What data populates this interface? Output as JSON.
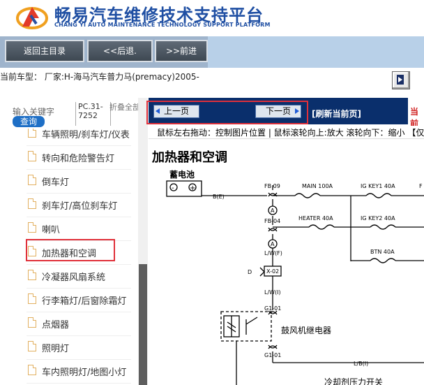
{
  "header": {
    "title": "畅易汽车维修技术支持平台",
    "subtitle": "CHANG YI AUTO MAINTENANCE TECHNOLOGY SUPPORT PLATFORM"
  },
  "toolbar": {
    "main_label": "返回主目录",
    "back_label": "<<后退.",
    "forward_label": ">>前进"
  },
  "car": {
    "label": "当前车型： 厂家:H-海马汽车普力马(premacy)2005-"
  },
  "search": {
    "keyword_label": "输入关键字",
    "query_label": "查询",
    "pc_code": "PC.31-7252",
    "collapse_label": "折叠全部"
  },
  "tree": {
    "items": [
      {
        "label": "车辆照明/刹车灯/仪表"
      },
      {
        "label": "转向和危险警告灯"
      },
      {
        "label": "倒车灯"
      },
      {
        "label": "刹车灯/高位刹车灯"
      },
      {
        "label": "喇叭"
      },
      {
        "label": "加热器和空调",
        "selected": true
      },
      {
        "label": "冷凝器风扇系统"
      },
      {
        "label": "行李箱灯/后窗除霜灯"
      },
      {
        "label": "点烟器"
      },
      {
        "label": "照明灯"
      },
      {
        "label": "车内照明灯/地图小灯"
      }
    ]
  },
  "pager": {
    "prev_label": "上一页",
    "next_label": "下一页",
    "refresh_label": "[刷新当前页]",
    "red_text": "当前"
  },
  "hint": "鼠标左右拖动：控制图片位置 | 鼠标滚轮向上:放大  滚轮向下：缩小 【仅",
  "diagram": {
    "title": "加热器和空调",
    "battery_label": "蓄电池",
    "labels": {
      "fb09": "FB 09",
      "main": "MAIN 100A",
      "igkey1": "IG KEY1 40A",
      "fb04": "FB-04",
      "heater": "HEATER 40A",
      "igkey2": "IG KEY2 40A",
      "btn": "BTN 40A",
      "be": "B(E)",
      "lwf": "L/W(F)",
      "x02": "X-02",
      "d": "D",
      "lwi": "L/W(I)",
      "g1a": "G1-01",
      "g1b": "G1-01",
      "relay": "鼓风机继电器",
      "lb": "L/B(I)",
      "bottom": "冷却剂压力开关",
      "a": "A",
      "f": "F",
      "minus": "-",
      "plus": "+"
    }
  }
}
